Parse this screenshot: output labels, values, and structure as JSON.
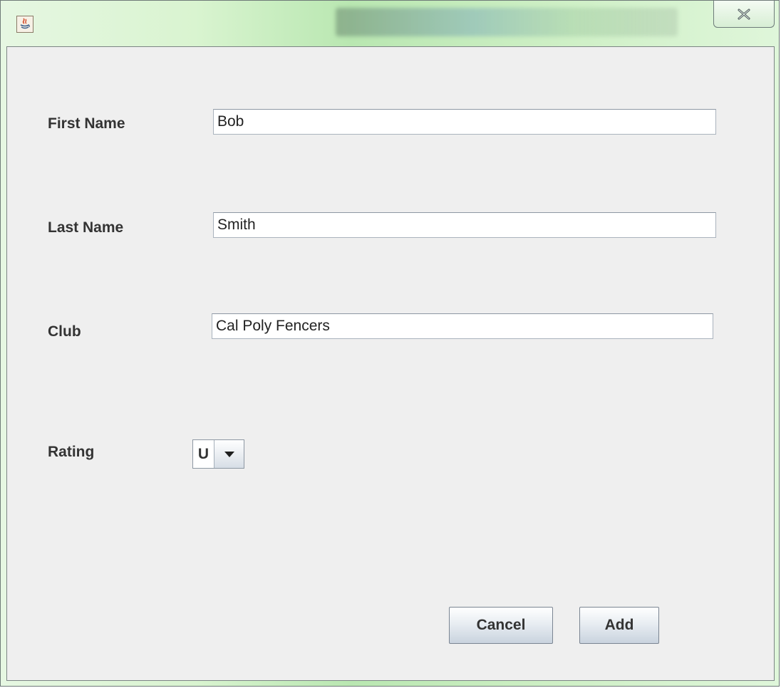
{
  "window": {
    "title": "",
    "close_icon": "close-x-icon"
  },
  "form": {
    "first_name": {
      "label": "First Name",
      "value": "Bob"
    },
    "last_name": {
      "label": "Last Name",
      "value": "Smith"
    },
    "club": {
      "label": "Club",
      "value": "Cal Poly Fencers"
    },
    "rating": {
      "label": "Rating",
      "value": "U"
    }
  },
  "buttons": {
    "cancel": "Cancel",
    "add": "Add"
  },
  "colors": {
    "titlebar_glass": "#cdeec4",
    "client_bg": "#efefef",
    "button_gradient_bottom": "#c9d3de"
  }
}
